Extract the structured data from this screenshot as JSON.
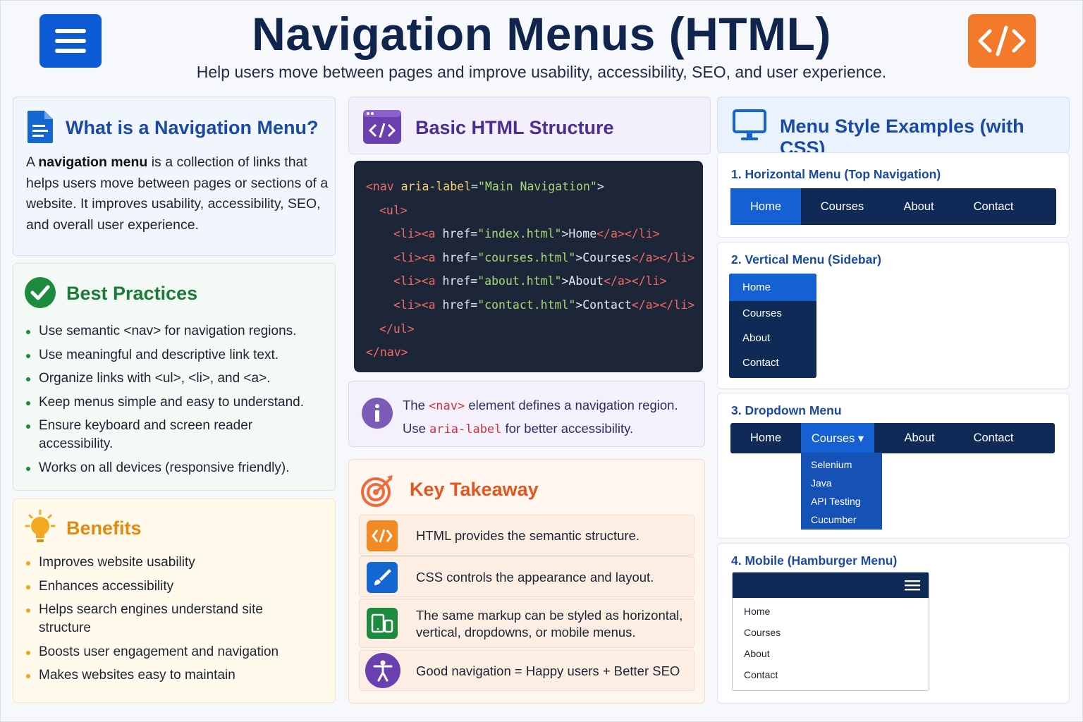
{
  "header": {
    "title": "Navigation Menus (HTML)",
    "subtitle": "Help users move between pages and improve usability, accessibility, SEO, and user experience."
  },
  "what": {
    "title": "What is a Navigation Menu?",
    "text_prefix": "A ",
    "text_bold": "navigation menu",
    "text_suffix": " is a collection of links that helps users move between pages or sections of a website. It improves usability, accessibility, SEO, and overall user experience."
  },
  "best": {
    "title": "Best Practices",
    "items": [
      "Use semantic <nav> for navigation regions.",
      "Use meaningful and descriptive link text.",
      "Organize links with <ul>, <li>, and <a>.",
      "Keep menus simple and easy to understand.",
      "Ensure keyboard and screen reader accessibility.",
      "Works on all devices (responsive friendly)."
    ]
  },
  "benefits": {
    "title": "Benefits",
    "items": [
      "Improves website usability",
      "Enhances accessibility",
      "Helps search engines understand site structure",
      "Boosts user engagement and navigation",
      "Makes websites easy to maintain"
    ]
  },
  "structure": {
    "title": "Basic HTML Structure",
    "code": {
      "l1": [
        "<nav ",
        "aria-label",
        "=",
        "\"Main Navigation\"",
        ">"
      ],
      "l2": [
        "<ul>"
      ],
      "l3": [
        "<li><a ",
        "href",
        "=",
        "\"index.html\"",
        ">Home",
        "</a></li>"
      ],
      "l4": [
        "<li><a ",
        "href",
        "=",
        "\"courses.html\"",
        ">Courses",
        "</a></li>"
      ],
      "l5": [
        "<li><a ",
        "href",
        "=",
        "\"about.html\"",
        ">About",
        "</a></li>"
      ],
      "l6": [
        "<li><a ",
        "href",
        "=",
        "\"contact.html\"",
        ">Contact",
        "</a></li>"
      ],
      "l7": [
        "</ul>"
      ],
      "l8": [
        "</nav>"
      ]
    }
  },
  "info": {
    "line1_a": "The ",
    "line1_kw": "<nav>",
    "line1_b": " element defines a navigation region.",
    "line2_a": "Use ",
    "line2_kw": "aria-label",
    "line2_b": " for better accessibility."
  },
  "takeaway": {
    "title": "Key Takeaway",
    "rows": [
      {
        "text": "HTML provides the semantic structure.",
        "icon": "code-icon",
        "color": "#f08a24"
      },
      {
        "text": "CSS controls the appearance and layout.",
        "icon": "brush-icon",
        "color": "#1466d0"
      },
      {
        "text": "The same markup can be styled as horizontal, vertical, dropdowns, or mobile menus.",
        "icon": "devices-icon",
        "color": "#1d8b3e"
      },
      {
        "text": "Good navigation = Happy users + Better SEO",
        "icon": "accessibility-icon",
        "color": "#6a3fb0"
      }
    ]
  },
  "styles": {
    "title": "Menu Style Examples (with CSS)",
    "s1": {
      "title": "1. Horizontal Menu (Top Navigation)",
      "items": [
        "Home",
        "Courses",
        "About",
        "Contact"
      ]
    },
    "s2": {
      "title": "2. Vertical Menu (Sidebar)",
      "items": [
        "Home",
        "Courses",
        "About",
        "Contact"
      ]
    },
    "s3": {
      "title": "3. Dropdown Menu",
      "items": [
        "Home",
        "Courses ▾",
        "About",
        "Contact"
      ],
      "dropdown": [
        "Selenium",
        "Java",
        "API Testing",
        "Cucumber"
      ]
    },
    "s4": {
      "title": "4. Mobile (Hamburger Menu)",
      "items": [
        "Home",
        "Courses",
        "About",
        "Contact"
      ]
    }
  },
  "colors": {
    "title_navy": "#10244e",
    "menu_blue": "#0d5bd4",
    "code_orange": "#f27a2a",
    "nav_dark": "#0f2a56",
    "nav_active": "#1560d2"
  }
}
